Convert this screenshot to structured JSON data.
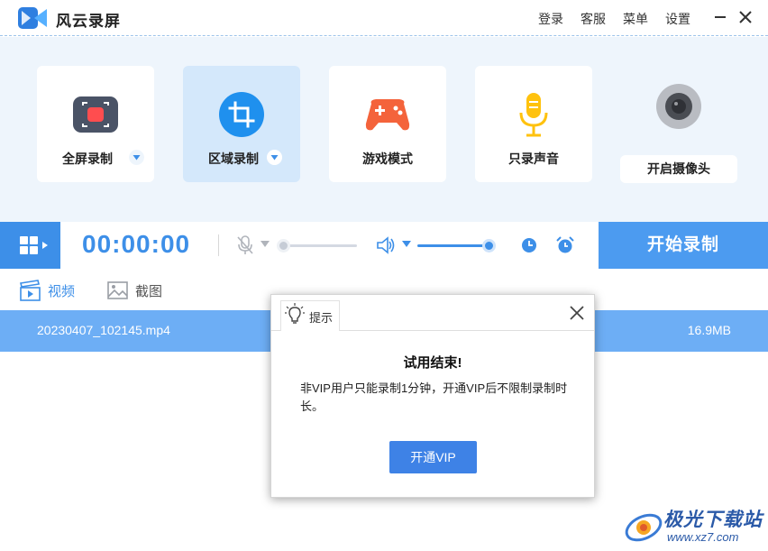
{
  "app": {
    "title": "风云录屏",
    "accent_color": "#3d8fe8"
  },
  "header": {
    "links": [
      "登录",
      "客服",
      "菜单",
      "设置"
    ],
    "minimize_icon": "minimize-icon",
    "close_icon": "close-icon"
  },
  "modes": [
    {
      "label": "全屏录制",
      "icon": "fullscreen-record-icon",
      "has_dropdown": true,
      "active": false
    },
    {
      "label": "区域录制",
      "icon": "area-crop-icon",
      "has_dropdown": true,
      "active": true
    },
    {
      "label": "游戏模式",
      "icon": "gamepad-icon",
      "has_dropdown": false,
      "active": false
    },
    {
      "label": "只录声音",
      "icon": "microphone-icon",
      "has_dropdown": false,
      "active": false
    }
  ],
  "camera": {
    "label": "开启摄像头",
    "icon": "webcam-icon"
  },
  "controls": {
    "timer": "00:00:00",
    "mic_level": 0,
    "speaker_level": 100,
    "start_label": "开始录制"
  },
  "tabs": [
    {
      "label": "视频",
      "icon": "video-clapper-icon",
      "active": true
    },
    {
      "label": "截图",
      "icon": "image-icon",
      "active": false
    }
  ],
  "files": [
    {
      "name": "20230407_102145.mp4",
      "size": "16.9MB"
    }
  ],
  "dialog": {
    "title": "提示",
    "heading": "试用结束!",
    "body": "非VIP用户只能录制1分钟，开通VIP后不限制录制时长。",
    "button": "开通VIP"
  },
  "watermark": {
    "text": "极光下载站",
    "url": "www.xz7.com"
  }
}
